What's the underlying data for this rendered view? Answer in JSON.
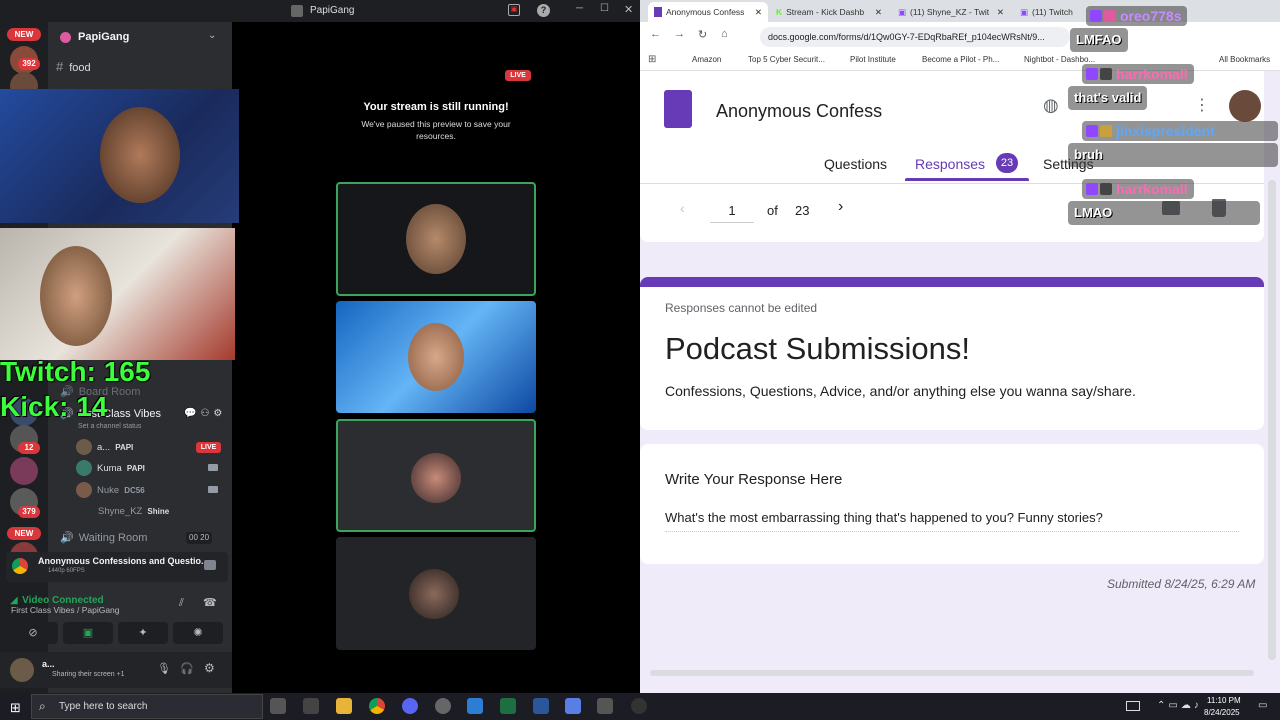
{
  "discord": {
    "window_title": "PapiGang",
    "server_name": "PapiGang",
    "badges": {
      "new": "NEW",
      "count1": "392",
      "count2": "12",
      "count3": "379"
    },
    "channels": {
      "food": "food",
      "board_room": "Board Room",
      "first_class": "First Class Vibes",
      "set_status": "Set a channel status",
      "waiting_room": "Waiting Room",
      "waiting_count": "00",
      "waiting_limit": "20"
    },
    "users": [
      {
        "name": "a...",
        "tag": "PAPI",
        "live": "LIVE"
      },
      {
        "name": "Kuma",
        "tag": "PAPI"
      },
      {
        "name": "Nuke",
        "tag": "DC56"
      },
      {
        "name": "Shyne_KZ",
        "tag": "Shine"
      }
    ],
    "stage": {
      "live": "LIVE",
      "title": "Your stream is still running!",
      "subtitle": "We've paused this preview to save your resources."
    },
    "activity": {
      "title": "Anonymous Confessions and Questio...",
      "sub": "1440p 60FPS"
    },
    "voice": {
      "status": "Video Connected",
      "channel": "First Class Vibes / PapiGang"
    },
    "user_panel": {
      "name": "a...",
      "status": "Sharing their screen +1"
    }
  },
  "overlay": {
    "twitch": "Twitch: 165",
    "kick": "Kick: 14"
  },
  "browser": {
    "tabs": [
      "Anonymous Confess",
      "Stream - Kick Dashb",
      "(11) Shyne_KZ - Twit",
      "(11) Twitch"
    ],
    "url": "docs.google.com/forms/d/1Qw0GY-7-EDqRbaREf_p104ecWRsNt/9...",
    "bookmarks": [
      "Amazon",
      "Top 5 Cyber Securit...",
      "Pilot Institute",
      "Become a Pilot - Ph...",
      "Nightbot - Dashbo...",
      "All Bookmarks"
    ]
  },
  "form": {
    "title": "Anonymous Confess",
    "tabs": {
      "questions": "Questions",
      "responses": "Responses",
      "responses_count": "23",
      "settings": "Settings"
    },
    "pager": {
      "current": "1",
      "of": "of",
      "total": "23"
    },
    "notice": "Responses cannot be edited",
    "heading": "Podcast Submissions!",
    "description": "Confessions, Questions, Advice, and/or anything else you wanna say/share.",
    "question": "Write Your Response Here",
    "answer": "What's the most embarrassing thing that's happened to you? Funny stories?",
    "submitted": "Submitted 8/24/25, 6:29 AM"
  },
  "chat": [
    {
      "user": "oreo778s",
      "color": "#c58cff",
      "message": "LMFAO"
    },
    {
      "user": "harrkomall",
      "color": "#ff69b4",
      "message": "that's valid"
    },
    {
      "user": "jinxispresident",
      "color": "#5aa9ff",
      "message": "bruh"
    },
    {
      "user": "harrkomall",
      "color": "#ff69b4",
      "message": "LMAO"
    }
  ],
  "taskbar": {
    "search": "Type here to search",
    "time": "11:10 PM",
    "date": "8/24/2025"
  }
}
